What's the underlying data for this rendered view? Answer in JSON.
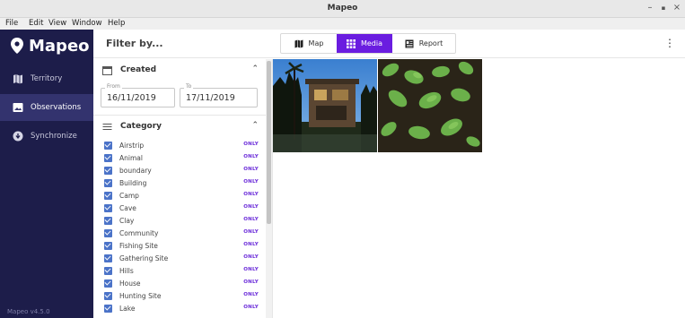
{
  "window": {
    "title": "Mapeo",
    "controls": [
      "–",
      "▪",
      "×"
    ]
  },
  "menu": [
    "File",
    "Edit",
    "View",
    "Window",
    "Help"
  ],
  "sidebar": {
    "brand": "Mapeo",
    "items": [
      {
        "label": "Territory",
        "icon": "map-icon"
      },
      {
        "label": "Observations",
        "icon": "photo-icon",
        "active": true
      },
      {
        "label": "Synchronize",
        "icon": "sync-icon"
      }
    ],
    "version": "Mapeo v4.5.0"
  },
  "filter": {
    "title": "Filter by...",
    "created": {
      "title": "Created",
      "from_label": "From",
      "from_value": "16/11/2019",
      "to_label": "To",
      "to_value": "17/11/2019"
    },
    "category": {
      "title": "Category",
      "only_label": "ONLY",
      "items": [
        "Airstrip",
        "Animal",
        "boundary",
        "Building",
        "Camp",
        "Cave",
        "Clay",
        "Community",
        "Fishing Site",
        "Gathering Site",
        "Hills",
        "House",
        "Hunting Site",
        "Lake"
      ]
    }
  },
  "main": {
    "tabs": [
      {
        "label": "Map",
        "icon": "map-icon"
      },
      {
        "label": "Media",
        "icon": "grid-icon",
        "active": true
      },
      {
        "label": "Report",
        "icon": "report-icon"
      }
    ],
    "menu_icon": "more-vert-icon"
  },
  "colors": {
    "sidebar_bg": "#1d1d4a",
    "accent": "#6a1de0",
    "checkbox": "#4b73c8"
  }
}
